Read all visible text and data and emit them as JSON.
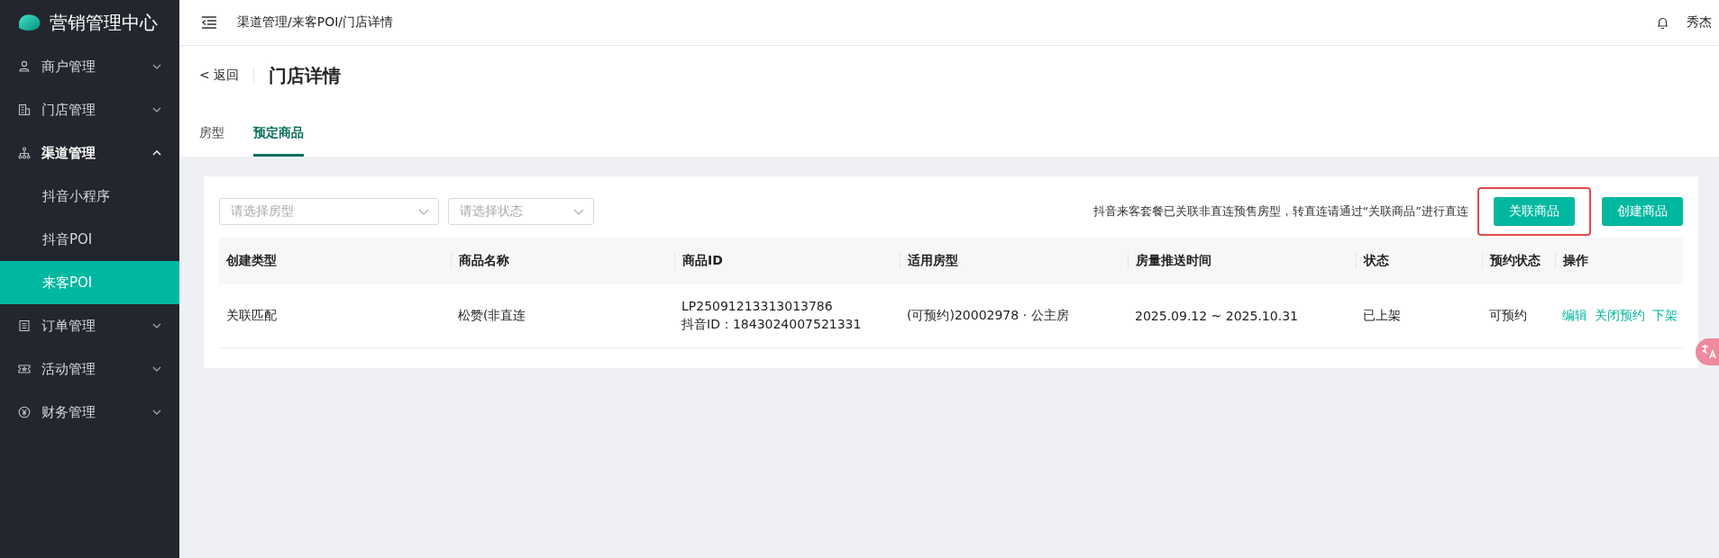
{
  "sidebar": {
    "logo_text": "营销管理中心",
    "items": [
      {
        "label": "商户管理",
        "expanded": false
      },
      {
        "label": "门店管理",
        "expanded": false
      },
      {
        "label": "渠道管理",
        "expanded": true,
        "children": [
          {
            "label": "抖音小程序",
            "selected": false
          },
          {
            "label": "抖音POI",
            "selected": false
          },
          {
            "label": "来客POI",
            "selected": true
          }
        ]
      },
      {
        "label": "订单管理",
        "expanded": false
      },
      {
        "label": "活动管理",
        "expanded": false
      },
      {
        "label": "财务管理",
        "expanded": false
      }
    ]
  },
  "topbar": {
    "breadcrumb": "渠道管理/来客POI/门店详情",
    "user": "秀杰"
  },
  "header": {
    "back": "< 返回",
    "title": "门店详情"
  },
  "tabs": [
    {
      "label": "房型",
      "selected": false
    },
    {
      "label": "预定商品",
      "selected": true
    }
  ],
  "filters": [
    {
      "placeholder": "请选择房型"
    },
    {
      "placeholder": "请选择状态"
    }
  ],
  "notice": "抖音来客套餐已关联非直连预售房型，转直连请通过“关联商品”进行直连",
  "buttons": [
    {
      "label": "关联商品",
      "highlighted": true
    },
    {
      "label": "创建商品",
      "highlighted": false
    }
  ],
  "table": {
    "columns": [
      "创建类型",
      "商品名称",
      "商品ID",
      "适用房型",
      "房量推送时间",
      "状态",
      "预约状态",
      "操作"
    ],
    "rows": [
      {
        "cells": [
          "关联匹配",
          "松赞(非直连",
          [
            "LP25091213313013786",
            "抖音ID：1843024007521331"
          ],
          "(可预约)20002978 · 公主房",
          "2025.09.12 ~ 2025.10.31",
          "已上架",
          "可预约"
        ],
        "actions": [
          "编辑",
          "关闭预约",
          "下架"
        ]
      }
    ]
  }
}
